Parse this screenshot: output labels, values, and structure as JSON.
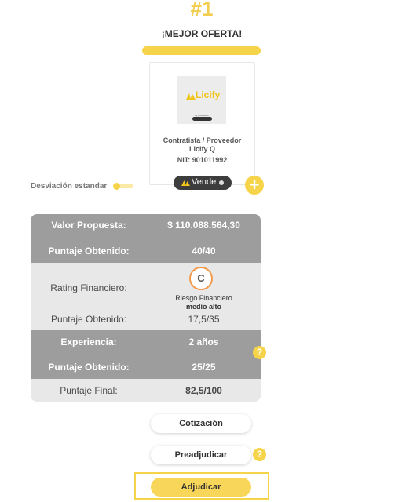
{
  "header": {
    "rank": "#1",
    "title": "¡MEJOR OFERTA!"
  },
  "card": {
    "logo_text": "Licify",
    "logo_sub": "by proveedor",
    "type_line1": "Contratista / Proveedor",
    "type_line2": "Licify Q",
    "nit": "NIT: 901011992"
  },
  "vende": {
    "label": "Vende"
  },
  "deviation": {
    "label": "Desviación estandar",
    "enabled": false
  },
  "table": {
    "valor_label": "Valor Propuesta:",
    "valor_value": "$ 110.088.564,30",
    "puntaje1_label": "Puntaje Obtenido:",
    "puntaje1_value": "40/40",
    "rating_label": "Rating Financiero:",
    "rating_grade": "C",
    "riesgo_label": "Riesgo Financiero",
    "riesgo_level": "medio alto",
    "puntaje2_label": "Puntaje Obtenido:",
    "puntaje2_value": "17,5/35",
    "experiencia_label": "Experiencia:",
    "experiencia_value": "2 años",
    "puntaje3_label": "Puntaje Obtenido:",
    "puntaje3_value": "25/25",
    "final_label": "Puntaje Final:",
    "final_value": "82,5/100"
  },
  "buttons": {
    "cotizacion": "Cotización",
    "preadjudicar": "Preadjudicar",
    "adjudicar": "Adjudicar"
  },
  "icons": {
    "help": "?",
    "add": "+"
  },
  "colors": {
    "accent": "#f6d44a",
    "table_dark": "#9d9d9d",
    "table_light": "#e8e8e8",
    "rating_ring": "#f39a4a"
  }
}
